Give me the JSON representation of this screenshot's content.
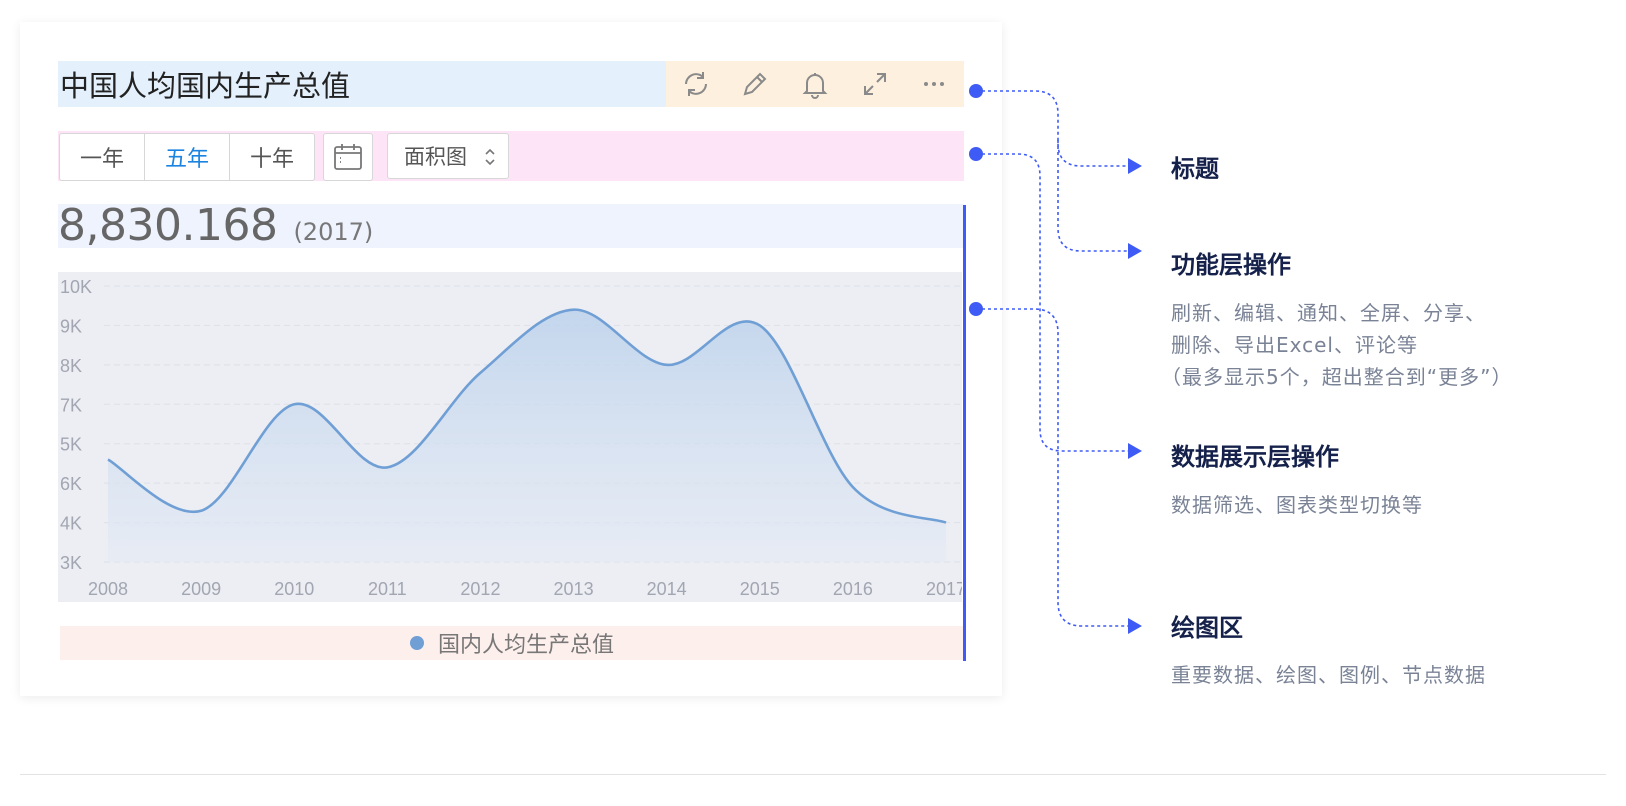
{
  "widget": {
    "title": "中国人均国内生产总值",
    "toolbar_icons": [
      "refresh-icon",
      "edit-icon",
      "bell-icon",
      "expand-icon",
      "more-icon"
    ],
    "ranges": [
      {
        "label": "一年",
        "active": false
      },
      {
        "label": "五年",
        "active": true
      },
      {
        "label": "十年",
        "active": false
      }
    ],
    "chart_type_select": "面积图",
    "kpi": {
      "value": "8,830.168",
      "year": "(2017)"
    },
    "legend": "国内人均生产总值"
  },
  "chart_data": {
    "type": "area",
    "x": [
      "2008",
      "2009",
      "2010",
      "2011",
      "2012",
      "2013",
      "2014",
      "2015",
      "2016",
      "2017"
    ],
    "y_tick_labels": [
      "3K",
      "4K",
      "6K",
      "5K",
      "7K",
      "8K",
      "9K",
      "10K"
    ],
    "series": [
      {
        "name": "国内人均生产总值",
        "values": [
          5.6,
          4.3,
          7.0,
          5.4,
          7.8,
          9.4,
          8.0,
          9.0,
          4.9,
          4.0
        ],
        "color": "#6f9fd5"
      }
    ],
    "grid": true,
    "legend_position": "bottom"
  },
  "annotations": [
    {
      "title": "标题",
      "desc": []
    },
    {
      "title": "功能层操作",
      "desc": [
        "刷新、编辑、通知、全屏、分享、",
        "删除、导出Excel、评论等",
        "（最多显示5个，超出整合到“更多”）"
      ]
    },
    {
      "title": "数据展示层操作",
      "desc": [
        "数据筛选、图表类型切换等"
      ]
    },
    {
      "title": "绘图区",
      "desc": [
        "重要数据、绘图、图例、节点数据"
      ]
    }
  ],
  "colors": {
    "accent": "#3f5bf5",
    "active": "#1b84e0",
    "line": "#6f9fd5"
  }
}
